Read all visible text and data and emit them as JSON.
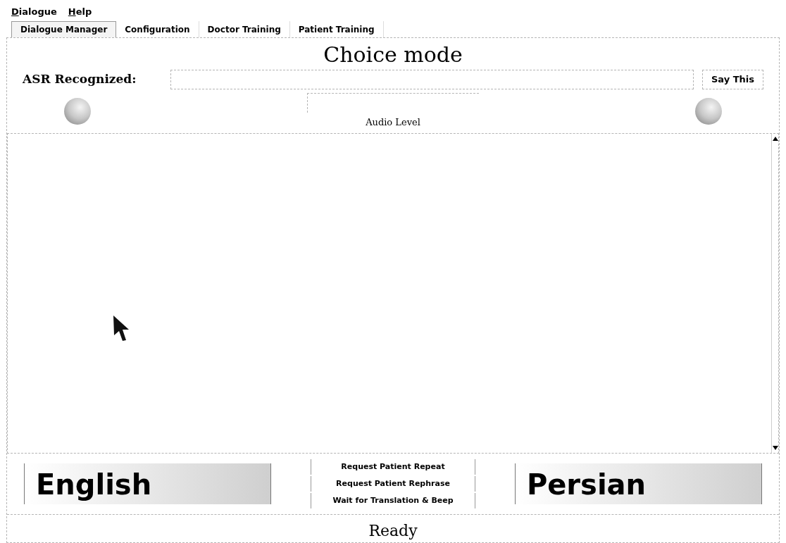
{
  "menu_bar": [
    {
      "label": "Dialogue"
    },
    {
      "label": "Help"
    }
  ],
  "tabs": [
    {
      "label": "Dialogue Manager",
      "selected": true
    },
    {
      "label": "Configuration",
      "selected": false
    },
    {
      "label": "Doctor Training",
      "selected": false
    },
    {
      "label": "Patient Training",
      "selected": false
    }
  ],
  "mode_title": "Choice mode",
  "asr": {
    "label": "ASR Recognized:",
    "button": "Say This"
  },
  "audio_meter": {
    "label": "Audio Level"
  },
  "language_buttons": [
    "English",
    "Persian"
  ],
  "action_buttons": [
    "Request Patient Repeat",
    "Request Patient Rephrase",
    "Wait for Translation & Beep"
  ],
  "status": "Ready"
}
